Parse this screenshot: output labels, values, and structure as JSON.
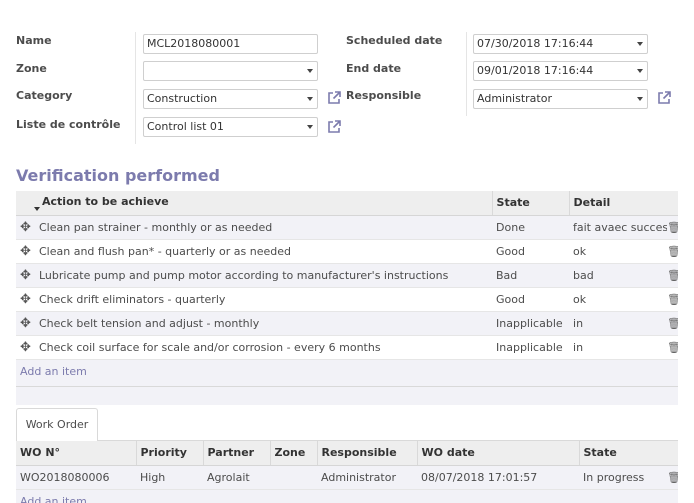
{
  "form": {
    "name_label": "Name",
    "name_value": "MCL2018080001",
    "zone_label": "Zone",
    "zone_value": "",
    "category_label": "Category",
    "category_value": "Construction",
    "checklist_label": "Liste de contrôle",
    "checklist_value": "Control list 01",
    "scheduled_label": "Scheduled date",
    "scheduled_value": "07/30/2018 17:16:44",
    "end_label": "End date",
    "end_value": "09/01/2018 17:16:44",
    "responsible_label": "Responsible",
    "responsible_value": "Administrator"
  },
  "verification": {
    "title": "Verification performed",
    "columns": [
      "Action to be achieve",
      "State",
      "Detail"
    ],
    "rows": [
      {
        "action": "Clean pan strainer - monthly or as needed",
        "state": "Done",
        "detail": "fait avaec succes"
      },
      {
        "action": "Clean and flush pan* - quarterly or as needed",
        "state": "Good",
        "detail": "ok"
      },
      {
        "action": "Lubricate pump and pump motor according to manufacturer's instructions",
        "state": "Bad",
        "detail": "bad"
      },
      {
        "action": "Check drift eliminators - quarterly",
        "state": "Good",
        "detail": "ok"
      },
      {
        "action": "Check belt tension and adjust - monthly",
        "state": "Inapplicable",
        "detail": "in"
      },
      {
        "action": "Check coil surface for scale and/or corrosion - every 6 months",
        "state": "Inapplicable",
        "detail": "in"
      }
    ],
    "add_item": "Add an item"
  },
  "work_order": {
    "tab_label": "Work Order",
    "columns": [
      "WO N°",
      "Priority",
      "Partner",
      "Zone",
      "Responsible",
      "WO date",
      "State"
    ],
    "rows": [
      {
        "wo": "WO2018080006",
        "priority": "High",
        "partner": "Agrolait",
        "zone": "",
        "responsible": "Administrator",
        "date": "08/07/2018 17:01:57",
        "state": "In progress"
      }
    ],
    "add_item": "Add an item"
  },
  "icons": {
    "external": "external-link-icon",
    "handle": "drag-handle-icon",
    "delete": "trash-icon",
    "dropdown": "chevron-down-icon"
  },
  "colors": {
    "accent": "#7c7bad",
    "row_alt": "#f2f2f7",
    "header_bg": "#eeeeee"
  }
}
